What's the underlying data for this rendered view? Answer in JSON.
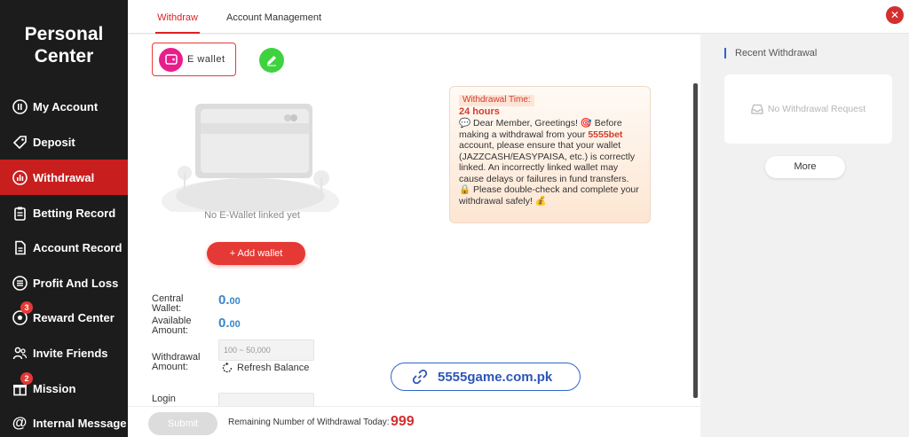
{
  "sidebar": {
    "title_line1": "Personal",
    "title_line2": "Center",
    "items": [
      {
        "label": "My Account",
        "icon": "user-circle-icon"
      },
      {
        "label": "Deposit",
        "icon": "tag-icon"
      },
      {
        "label": "Withdrawal",
        "icon": "bar-chart-icon",
        "active": true
      },
      {
        "label": "Betting Record",
        "icon": "clipboard-icon"
      },
      {
        "label": "Account Record",
        "icon": "file-icon"
      },
      {
        "label": "Profit And Loss",
        "icon": "list-icon"
      },
      {
        "label": "Reward Center",
        "icon": "soccer-ball-icon",
        "badge": "3"
      },
      {
        "label": "Invite Friends",
        "icon": "people-icon"
      },
      {
        "label": "Mission",
        "icon": "gift-icon",
        "badge": "2"
      },
      {
        "label": "Internal Message",
        "icon": "at-icon"
      }
    ]
  },
  "tabs": [
    {
      "label": "Withdraw",
      "active": true
    },
    {
      "label": "Account Management"
    }
  ],
  "main": {
    "ewallet_label": "E wallet",
    "no_wallet_text": "No E-Wallet linked yet",
    "add_wallet_label": "+ Add wallet",
    "central_wallet_label_1": "Central",
    "central_wallet_label_2": "Wallet:",
    "central_wallet_int": "0.",
    "central_wallet_dec": "00",
    "available_label_1": "Available",
    "available_label_2": "Amount:",
    "available_int": "0.",
    "available_dec": "00",
    "withdrawal_amount_label_1": "Withdrawal",
    "withdrawal_amount_label_2": "Amount:",
    "amount_placeholder": "100 ~ 50,000",
    "refresh_label": "Refresh Balance",
    "login_label": "Login"
  },
  "notice": {
    "title": "Withdrawal Time:",
    "hours": "24 hours",
    "body_1": "💬 Dear Member, Greetings! 🎯 Before making a withdrawal from your ",
    "brand": "5555bet",
    "body_2": " account, please ensure that your wallet (JAZZCASH/EASYPAISA, etc.) is correctly linked. An incorrectly linked wallet may cause delays or failures in fund transfers.\n🔒 Please double-check and complete your withdrawal safely! 💰"
  },
  "site_link": "5555game.com.pk",
  "bottom": {
    "submit_label": "Submit",
    "remaining_label": "Remaining Number of Withdrawal Today:",
    "remaining_count": "999"
  },
  "right": {
    "recent_title": "Recent Withdrawal",
    "empty_text": "No Withdrawal Request",
    "more_label": "More"
  },
  "colors": {
    "sidebar_bg": "#1c1c1c",
    "active_red": "#c81e1e",
    "accent_blue": "#2f66c8",
    "edit_green": "#3ed23e",
    "ewallet_pink": "#e91e8c"
  }
}
